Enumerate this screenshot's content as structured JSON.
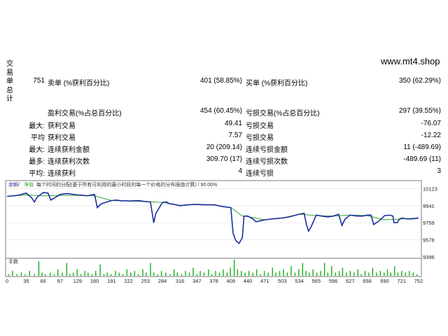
{
  "side_title": "交易单总计",
  "brand": "www.mt4.shop",
  "stats": {
    "total_trades": "751",
    "short_label": "卖单 (%获利百分比)",
    "short_value": "401 (58.85%)",
    "long_label": "买单 (%获利百分比)",
    "long_value": "350 (62.29%)",
    "profit_trades_label": "盈利交易(%占总百分比)",
    "profit_trades_value": "454 (60.45%)",
    "loss_trades_label": "亏损交易(%占总百分比)",
    "loss_trades_value": "297 (39.55%)",
    "max_prefix": "最大:",
    "avg_prefix": "平均",
    "max_prefix2": "最大:",
    "most_prefix": "最多:",
    "avg_prefix2": "平均:",
    "largest_profit_label": "获利交易",
    "largest_profit_value": "49.41",
    "largest_loss_label": "亏损交易",
    "largest_loss_value": "-76.07",
    "avg_profit_label": "获利交易",
    "avg_profit_value": "7.57",
    "avg_loss_label": "亏损交易",
    "avg_loss_value": "-12.22",
    "max_cons_win_money_label": "连续获利金额",
    "max_cons_win_money_value": "20 (209.14)",
    "max_cons_loss_money_label": "连续亏损金额",
    "max_cons_loss_money_value": "11 (-489.69)",
    "max_cons_win_count_label": "连续获利次数",
    "max_cons_win_count_value": "309.70 (17)",
    "max_cons_loss_count_label": "连续亏损次数",
    "max_cons_loss_count_value": "-489.69 (11)",
    "avg_cons_win_label": "连续获利",
    "avg_cons_win_value": "4",
    "avg_cons_loss_label": "连续亏损",
    "avg_cons_loss_value": "3"
  },
  "chart_data": {
    "type": "line",
    "legend_balance": "余额",
    "legend_sep": " / ",
    "legend_equity": "净值",
    "caption": "每个时间的分配(基于所有可利用的最小时段的每一个价格的分布插值计算) / 90.00%",
    "colors": {
      "balance": "#1c2ea0",
      "equity": "#2ea52e",
      "volume": "#12b012"
    },
    "y_ticks": [
      "10123",
      "9941",
      "9759",
      "9578",
      "9396"
    ],
    "y_tick_values": [
      10123,
      9941,
      9759,
      9578,
      9396
    ],
    "ylim": [
      9396,
      10170
    ],
    "x_ticks": [
      "0",
      "35",
      "66",
      "97",
      "129",
      "160",
      "191",
      "222",
      "253",
      "284",
      "316",
      "347",
      "378",
      "409",
      "440",
      "471",
      "503",
      "534",
      "565",
      "596",
      "627",
      "658",
      "690",
      "721",
      "752"
    ],
    "xlim": [
      0,
      752
    ],
    "volume_label": "手数",
    "balance": [
      [
        0,
        10040
      ],
      [
        20,
        10050
      ],
      [
        35,
        10075
      ],
      [
        45,
        10025
      ],
      [
        50,
        9980
      ],
      [
        55,
        10030
      ],
      [
        66,
        10080
      ],
      [
        75,
        10075
      ],
      [
        80,
        10000
      ],
      [
        86,
        10020
      ],
      [
        97,
        10060
      ],
      [
        110,
        10070
      ],
      [
        129,
        10055
      ],
      [
        140,
        10050
      ],
      [
        145,
        10045
      ],
      [
        160,
        10060
      ],
      [
        165,
        9920
      ],
      [
        172,
        9960
      ],
      [
        191,
        9995
      ],
      [
        200,
        10000
      ],
      [
        210,
        9990
      ],
      [
        215,
        9995
      ],
      [
        222,
        9990
      ],
      [
        240,
        9995
      ],
      [
        253,
        9985
      ],
      [
        262,
        9980
      ],
      [
        268,
        9760
      ],
      [
        272,
        9860
      ],
      [
        284,
        9975
      ],
      [
        292,
        9980
      ],
      [
        297,
        9960
      ],
      [
        305,
        9955
      ],
      [
        316,
        9940
      ],
      [
        330,
        9950
      ],
      [
        347,
        9955
      ],
      [
        360,
        9950
      ],
      [
        378,
        9950
      ],
      [
        395,
        9930
      ],
      [
        409,
        9920
      ],
      [
        413,
        9650
      ],
      [
        418,
        9570
      ],
      [
        424,
        9540
      ],
      [
        430,
        9600
      ],
      [
        433,
        9830
      ],
      [
        440,
        9830
      ],
      [
        449,
        9800
      ],
      [
        455,
        9770
      ],
      [
        471,
        9790
      ],
      [
        485,
        9800
      ],
      [
        503,
        9810
      ],
      [
        515,
        9820
      ],
      [
        534,
        9850
      ],
      [
        543,
        9860
      ],
      [
        547,
        9740
      ],
      [
        551,
        9670
      ],
      [
        556,
        9720
      ],
      [
        565,
        9840
      ],
      [
        575,
        9830
      ],
      [
        586,
        9820
      ],
      [
        596,
        9830
      ],
      [
        606,
        9850
      ],
      [
        612,
        9730
      ],
      [
        618,
        9800
      ],
      [
        627,
        9840
      ],
      [
        640,
        9830
      ],
      [
        650,
        9830
      ],
      [
        658,
        9840
      ],
      [
        665,
        9840
      ],
      [
        670,
        9740
      ],
      [
        680,
        9780
      ],
      [
        690,
        9835
      ],
      [
        700,
        9840
      ],
      [
        705,
        9830
      ],
      [
        707,
        9760
      ],
      [
        713,
        9760
      ],
      [
        716,
        9790
      ],
      [
        721,
        9810
      ],
      [
        730,
        9800
      ],
      [
        740,
        9800
      ],
      [
        752,
        9810
      ]
    ],
    "equity": [
      [
        0,
        10040
      ],
      [
        35,
        10055
      ],
      [
        66,
        10045
      ],
      [
        97,
        10050
      ],
      [
        129,
        10050
      ],
      [
        160,
        10045
      ],
      [
        191,
        9995
      ],
      [
        222,
        9990
      ],
      [
        253,
        9985
      ],
      [
        284,
        9975
      ],
      [
        316,
        9945
      ],
      [
        347,
        9955
      ],
      [
        378,
        9950
      ],
      [
        409,
        9920
      ],
      [
        430,
        9830
      ],
      [
        440,
        9825
      ],
      [
        471,
        9790
      ],
      [
        503,
        9810
      ],
      [
        534,
        9850
      ],
      [
        565,
        9835
      ],
      [
        596,
        9830
      ],
      [
        627,
        9840
      ],
      [
        658,
        9835
      ],
      [
        690,
        9790
      ],
      [
        721,
        9800
      ],
      [
        752,
        9810
      ]
    ],
    "volume": [
      [
        3,
        1
      ],
      [
        10,
        3
      ],
      [
        18,
        1
      ],
      [
        26,
        2
      ],
      [
        33,
        1
      ],
      [
        41,
        3
      ],
      [
        50,
        1
      ],
      [
        58,
        9
      ],
      [
        64,
        2
      ],
      [
        70,
        1
      ],
      [
        79,
        2
      ],
      [
        86,
        1
      ],
      [
        93,
        4
      ],
      [
        101,
        2
      ],
      [
        109,
        8
      ],
      [
        115,
        1
      ],
      [
        121,
        2
      ],
      [
        128,
        4
      ],
      [
        135,
        1
      ],
      [
        142,
        3
      ],
      [
        148,
        2
      ],
      [
        155,
        1
      ],
      [
        162,
        3
      ],
      [
        170,
        7
      ],
      [
        177,
        1
      ],
      [
        183,
        2
      ],
      [
        190,
        1
      ],
      [
        198,
        3
      ],
      [
        205,
        2
      ],
      [
        212,
        1
      ],
      [
        219,
        4
      ],
      [
        226,
        2
      ],
      [
        233,
        3
      ],
      [
        240,
        1
      ],
      [
        248,
        4
      ],
      [
        254,
        2
      ],
      [
        262,
        8
      ],
      [
        268,
        2
      ],
      [
        275,
        1
      ],
      [
        282,
        3
      ],
      [
        290,
        2
      ],
      [
        298,
        1
      ],
      [
        305,
        4
      ],
      [
        311,
        2
      ],
      [
        319,
        1
      ],
      [
        326,
        3
      ],
      [
        333,
        2
      ],
      [
        340,
        5
      ],
      [
        347,
        1
      ],
      [
        353,
        3
      ],
      [
        360,
        2
      ],
      [
        368,
        4
      ],
      [
        374,
        1
      ],
      [
        381,
        3
      ],
      [
        388,
        2
      ],
      [
        395,
        4
      ],
      [
        402,
        2
      ],
      [
        408,
        5
      ],
      [
        415,
        10
      ],
      [
        421,
        4
      ],
      [
        428,
        3
      ],
      [
        435,
        2
      ],
      [
        442,
        3
      ],
      [
        449,
        2
      ],
      [
        456,
        4
      ],
      [
        463,
        1
      ],
      [
        470,
        3
      ],
      [
        477,
        2
      ],
      [
        485,
        5
      ],
      [
        491,
        2
      ],
      [
        498,
        3
      ],
      [
        505,
        4
      ],
      [
        512,
        2
      ],
      [
        519,
        6
      ],
      [
        526,
        2
      ],
      [
        533,
        4
      ],
      [
        540,
        8
      ],
      [
        546,
        3
      ],
      [
        552,
        2
      ],
      [
        559,
        4
      ],
      [
        566,
        2
      ],
      [
        573,
        3
      ],
      [
        580,
        8
      ],
      [
        586,
        2
      ],
      [
        593,
        6
      ],
      [
        600,
        2
      ],
      [
        607,
        3
      ],
      [
        613,
        5
      ],
      [
        620,
        2
      ],
      [
        627,
        3
      ],
      [
        634,
        2
      ],
      [
        641,
        4
      ],
      [
        647,
        1
      ],
      [
        654,
        3
      ],
      [
        661,
        2
      ],
      [
        668,
        5
      ],
      [
        675,
        2
      ],
      [
        682,
        3
      ],
      [
        689,
        2
      ],
      [
        695,
        4
      ],
      [
        701,
        2
      ],
      [
        708,
        6
      ],
      [
        714,
        2
      ],
      [
        721,
        3
      ],
      [
        728,
        2
      ],
      [
        735,
        3
      ],
      [
        742,
        2
      ],
      [
        749,
        1
      ]
    ]
  }
}
